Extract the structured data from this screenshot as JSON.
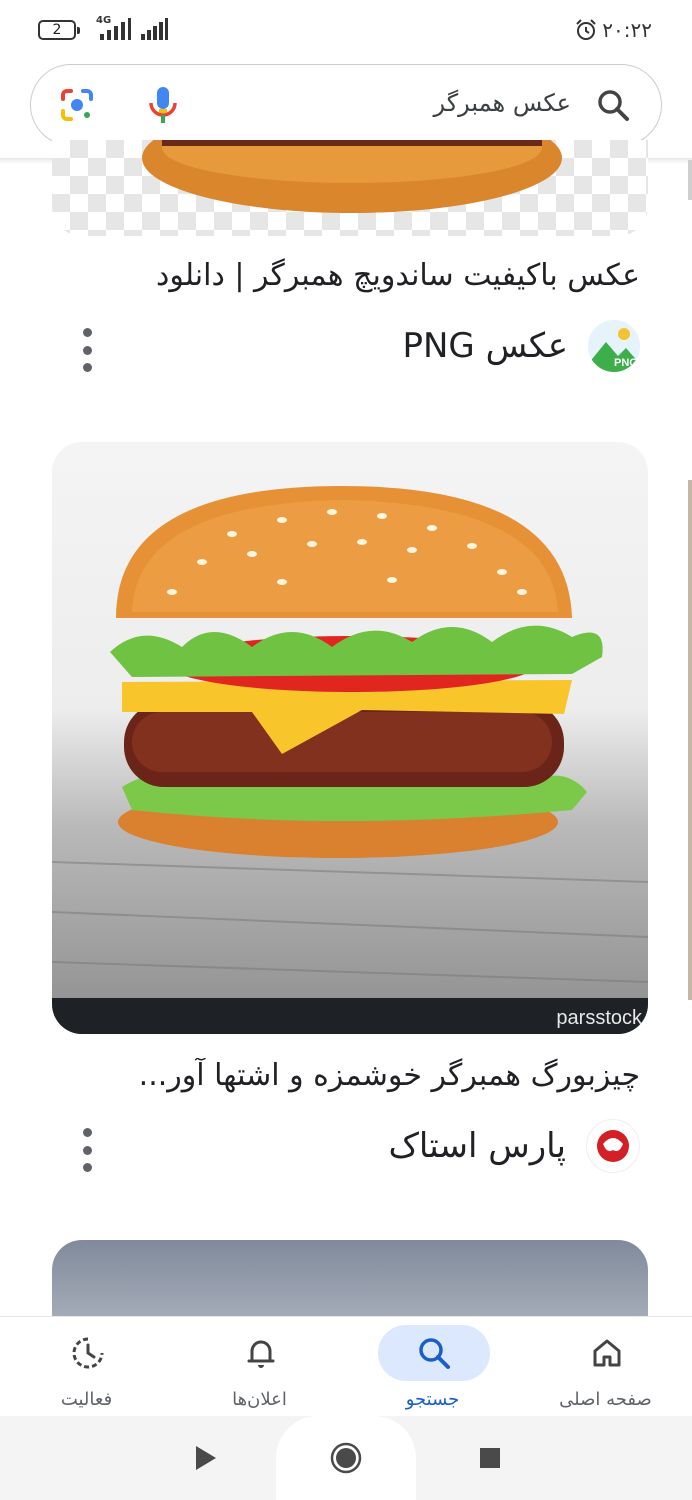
{
  "status_bar": {
    "time": "۲۰:۲۲",
    "battery": "2",
    "network": "4G"
  },
  "search": {
    "query": "عکس همبرگر"
  },
  "results": [
    {
      "title": "عکس باکیفیت ساندویچ همبرگر | دانلود",
      "source": "عکس PNG",
      "logo_text": "PNG"
    },
    {
      "title": "چیزبورگ همبرگر خوشمزه و اشتها آور...",
      "source": "پارس استاک",
      "watermark": "parsstock"
    }
  ],
  "bottom_nav": {
    "items": [
      {
        "label": "فعالیت",
        "icon": "activity-icon"
      },
      {
        "label": "اعلان‌ها",
        "icon": "bell-icon"
      },
      {
        "label": "جستجو",
        "icon": "search-icon",
        "active": true
      },
      {
        "label": "صفحه اصلی",
        "icon": "home-icon"
      }
    ]
  },
  "colors": {
    "accent": "#1a5ec7",
    "active_pill": "#dbe8fd"
  }
}
